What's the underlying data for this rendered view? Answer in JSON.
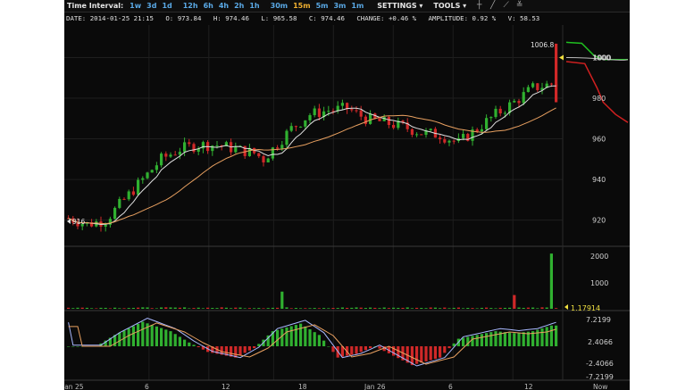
{
  "toolbar": {
    "time_interval_label": "Time Interval:",
    "intervals": [
      "1w",
      "3d",
      "1d",
      "12h",
      "6h",
      "4h",
      "2h",
      "1h",
      "30m",
      "15m",
      "5m",
      "3m",
      "1m"
    ],
    "active_interval": "15m",
    "settings_label": "SETTINGS",
    "tools_label": "TOOLS",
    "tools": [
      "cross-icon",
      "line-icon",
      "trend-icon",
      "fib-icon"
    ]
  },
  "info": {
    "date": "DATE: 2014-01-25 21:15",
    "open": "O: 973.84",
    "high": "H: 974.46",
    "low": "L: 965.58",
    "close": "C: 974.46",
    "change": "CHANGE: +0.46 %",
    "amplitude": "AMPLITUDE: 0.92 %",
    "volume": "V: 58.53"
  },
  "colors": {
    "up": "#30b030",
    "down": "#d02828",
    "ma_fast": "#e0e0e0",
    "ma_slow": "#e8a060",
    "grid": "#1e1e1e",
    "marker": "#f0e040",
    "depth_bid": "#20c020",
    "depth_ask": "#d02020"
  },
  "chart_data": {
    "type": "candlestick",
    "price_axis": {
      "ticks": [
        "1000",
        "980",
        "960",
        "940",
        "920"
      ],
      "min": 908,
      "max": 1016
    },
    "price_labels": {
      "high_marker": "1006.8",
      "low_marker": "916",
      "current": "1000"
    },
    "volume_axis": {
      "ticks": [
        "2000",
        "1000"
      ],
      "current_label": "1.17914"
    },
    "macd_axis": {
      "ticks": [
        "7.2199",
        "2.4066",
        "-2.4066",
        "-7.2199"
      ]
    },
    "x_labels": [
      "Jan 25",
      "6",
      "12",
      "18",
      "Jan 26",
      "6",
      "12",
      "Now"
    ],
    "price_keys": [
      [
        0,
        921
      ],
      [
        4,
        918
      ],
      [
        8,
        920
      ],
      [
        12,
        930
      ],
      [
        16,
        940
      ],
      [
        20,
        950
      ],
      [
        24,
        955
      ],
      [
        28,
        957
      ],
      [
        32,
        957
      ],
      [
        36,
        955
      ],
      [
        40,
        953
      ],
      [
        42,
        950
      ],
      [
        44,
        955
      ],
      [
        48,
        965
      ],
      [
        52,
        972
      ],
      [
        56,
        974
      ],
      [
        60,
        975
      ],
      [
        64,
        970
      ],
      [
        68,
        968
      ],
      [
        72,
        966
      ],
      [
        76,
        963
      ],
      [
        80,
        962
      ],
      [
        84,
        958
      ],
      [
        88,
        965
      ],
      [
        92,
        972
      ],
      [
        96,
        978
      ],
      [
        100,
        985
      ],
      [
        104,
        987
      ],
      [
        105,
        987
      ]
    ],
    "volume_spikes": [
      [
        46,
        700
      ],
      [
        96,
        560
      ],
      [
        104,
        2250
      ]
    ],
    "volume_base": 40,
    "macd_keys": [
      [
        0,
        0
      ],
      [
        6,
        0
      ],
      [
        10,
        3
      ],
      [
        16,
        6.5
      ],
      [
        22,
        4
      ],
      [
        26,
        1
      ],
      [
        30,
        -1.5
      ],
      [
        36,
        -3
      ],
      [
        40,
        -0.5
      ],
      [
        44,
        4
      ],
      [
        50,
        6
      ],
      [
        54,
        3
      ],
      [
        58,
        -3
      ],
      [
        62,
        -2
      ],
      [
        66,
        0
      ],
      [
        70,
        -2.5
      ],
      [
        74,
        -5
      ],
      [
        80,
        -3
      ],
      [
        84,
        2
      ],
      [
        88,
        3
      ],
      [
        92,
        4
      ],
      [
        96,
        3.5
      ],
      [
        100,
        4
      ],
      [
        104,
        5.5
      ],
      [
        105,
        5.5
      ]
    ],
    "depth": {
      "bid": [
        [
          0,
          1007.5
        ],
        [
          0.25,
          1007
        ],
        [
          0.45,
          1001
        ],
        [
          0.6,
          999
        ],
        [
          1,
          999
        ]
      ],
      "ask": [
        [
          0,
          998
        ],
        [
          0.3,
          997
        ],
        [
          0.5,
          985
        ],
        [
          0.6,
          978
        ],
        [
          0.8,
          972
        ],
        [
          1,
          968
        ]
      ]
    }
  }
}
